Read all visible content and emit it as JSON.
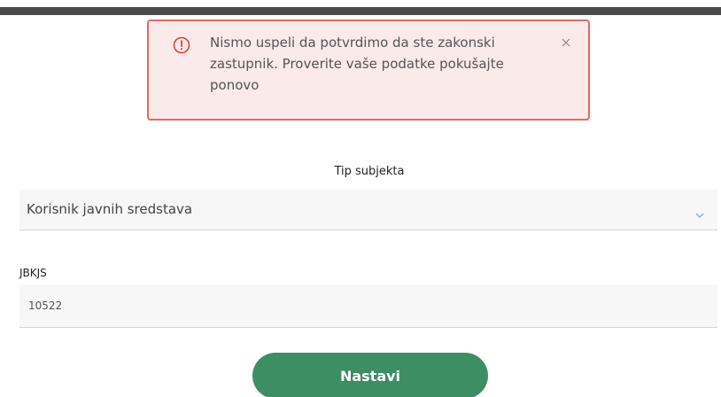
{
  "alert": {
    "icon": "exclamation-circle-icon",
    "message": "Nismo uspeli da potvrdimo da ste zakonski zastupnik. Proverite vaše podatke pokušajte ponovo",
    "close_icon": "close-icon",
    "colors": {
      "background": "#fbeaea",
      "border": "#e06b62"
    }
  },
  "form": {
    "subject_type": {
      "label": "Tip subjekta",
      "selected": "Korisnik javnih sredstava",
      "icon": "chevron-down-icon"
    },
    "jbkjs": {
      "label": "JBKJS",
      "value": "10522"
    },
    "submit_label": "Nastavi"
  },
  "colors": {
    "accent": "#3e8e63"
  }
}
